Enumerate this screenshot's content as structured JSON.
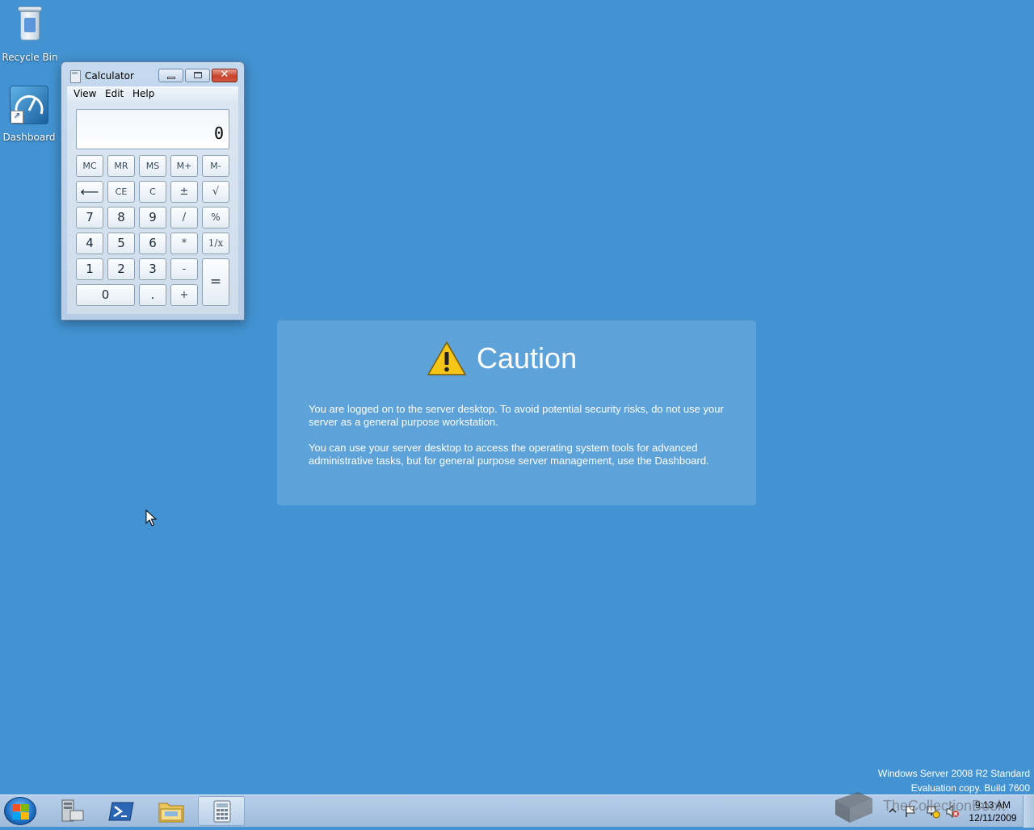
{
  "desktop": {
    "icons": [
      {
        "label": "Recycle Bin",
        "icon": "recycle-bin-icon"
      },
      {
        "label": "Dashboard",
        "icon": "dashboard-icon"
      }
    ],
    "background_color": "#4393d2"
  },
  "calculator": {
    "title": "Calculator",
    "menu": {
      "view": "View",
      "edit": "Edit",
      "help": "Help"
    },
    "display": "0",
    "keys": {
      "mc": "MC",
      "mr": "MR",
      "ms": "MS",
      "mplus": "M+",
      "mminus": "M-",
      "back": "⟵",
      "ce": "CE",
      "c": "C",
      "plusminus": "±",
      "sqrt": "√",
      "k7": "7",
      "k8": "8",
      "k9": "9",
      "div": "/",
      "pct": "%",
      "k4": "4",
      "k5": "5",
      "k6": "6",
      "mul": "*",
      "recip": "1/x",
      "k1": "1",
      "k2": "2",
      "k3": "3",
      "sub": "-",
      "eq": "=",
      "k0": "0",
      "dot": ".",
      "add": "+"
    }
  },
  "caution": {
    "title": "Caution",
    "p1": "You are logged on to the server desktop. To avoid potential security risks, do not use your server as a general purpose workstation.",
    "p2": "You can use your server desktop to access the operating system tools for advanced administrative tasks, but for general purpose server management, use the Dashboard."
  },
  "watermark": {
    "line1": "Windows Server 2008 R2 Standard",
    "line2": "Evaluation copy. Build 7600"
  },
  "taskbar": {
    "apps": [
      "server-manager-icon",
      "powershell-icon",
      "explorer-icon",
      "calculator-icon"
    ],
    "time": "9:13 AM",
    "date": "12/11/2009"
  },
  "overlay_logo_text": "TheCollectionBook"
}
